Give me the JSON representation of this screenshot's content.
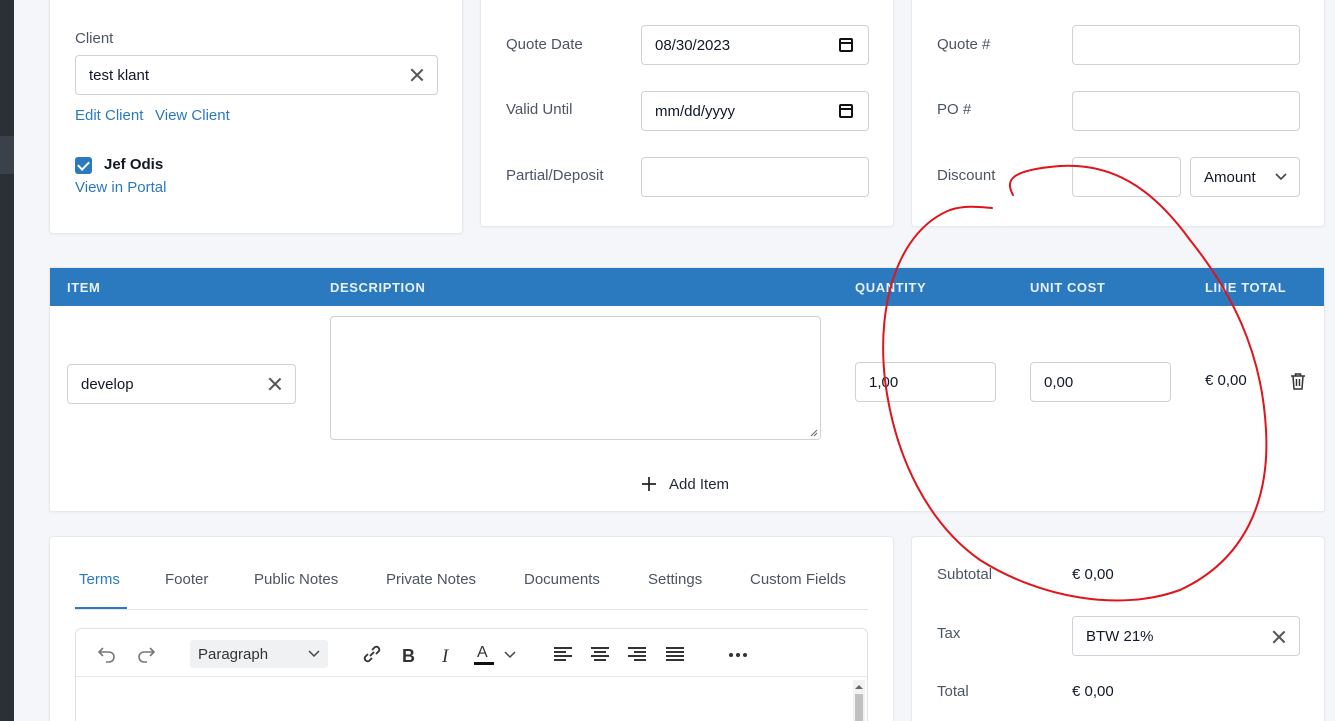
{
  "client": {
    "label": "Client",
    "value": "test klant",
    "edit_link": "Edit Client",
    "view_link": "View Client",
    "contact_name": "Jef Odis",
    "contact_checked": true,
    "portal_link": "View in Portal"
  },
  "dates": {
    "quote_date_label": "Quote Date",
    "quote_date_value": "08/30/2023",
    "valid_until_label": "Valid Until",
    "valid_until_placeholder": "mm/dd/yyyy",
    "partial_label": "Partial/Deposit",
    "partial_value": ""
  },
  "meta": {
    "quote_num_label": "Quote #",
    "quote_num_value": "",
    "po_num_label": "PO #",
    "po_num_value": "",
    "discount_label": "Discount",
    "discount_value": "",
    "discount_type": "Amount"
  },
  "items_table": {
    "headers": [
      "ITEM",
      "DESCRIPTION",
      "QUANTITY",
      "UNIT COST",
      "LINE TOTAL"
    ],
    "rows": [
      {
        "item": "develop",
        "description": "",
        "quantity": "1,00",
        "unit_cost": "0,00",
        "line_total": "€ 0,00"
      }
    ],
    "add_item_label": "Add Item"
  },
  "notes_tabs": {
    "tabs": [
      "Terms",
      "Footer",
      "Public Notes",
      "Private Notes",
      "Documents",
      "Settings",
      "Custom Fields"
    ],
    "active": "Terms"
  },
  "editor": {
    "block_format": "Paragraph"
  },
  "totals": {
    "subtotal_label": "Subtotal",
    "subtotal_value": "€ 0,00",
    "tax_label": "Tax",
    "tax_value": "BTW 21%",
    "total_label": "Total",
    "total_value": "€ 0,00"
  },
  "colors": {
    "accent": "#2b79be",
    "annotation": "#e0141b"
  }
}
